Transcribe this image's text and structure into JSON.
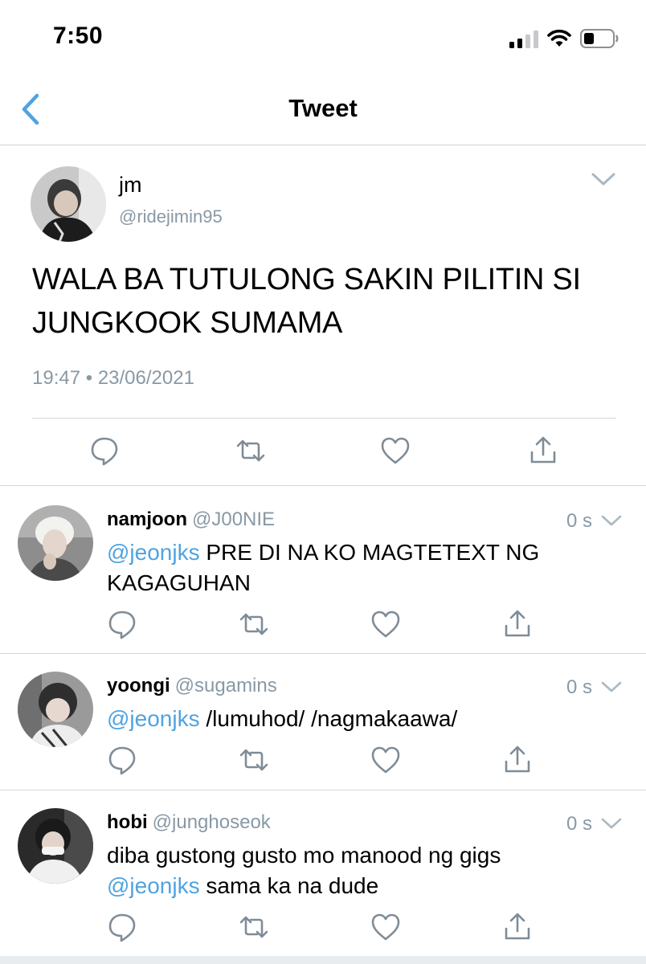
{
  "status_bar": {
    "time": "7:50"
  },
  "nav": {
    "title": "Tweet"
  },
  "main_tweet": {
    "name": "jm",
    "handle": "@ridejimin95",
    "text_line1": "WALA BA TUTULONG SAKIN PILITIN SI",
    "text_line2": "JUNGKOOK SUMAMA",
    "time": "19:47",
    "separator": "•",
    "date": "23/06/2021"
  },
  "replies": [
    {
      "name": "namjoon",
      "handle": "@J00NIE",
      "time": "0 s",
      "line1_mention": "@jeonjks",
      "line1_text": " PRE DI NA KO MAGTETEXT NG",
      "line2_text": "KAGAGUHAN"
    },
    {
      "name": "yoongi",
      "handle": "@sugamins",
      "time": "0 s",
      "line1_mention": "@jeonjks",
      "line1_text": " /lumuhod/ /nagmakaawa/"
    },
    {
      "name": "hobi",
      "handle": "@junghoseok",
      "time": "0 s",
      "line1_text": "diba gustong gusto mo manood ng gigs",
      "line2_mention": "@jeonjks",
      "line2_text": " sama ka na dude"
    }
  ],
  "colors": {
    "accent": "#4fa3e0",
    "secondary_text": "#8899a6",
    "divider": "#d3d7da",
    "icon": "#7f8c97"
  },
  "icons": {
    "back": "chevron-left-icon",
    "more": "chevron-down-icon",
    "reply": "speech-bubble-icon",
    "retweet": "retweet-icon",
    "like": "heart-icon",
    "share": "share-icon"
  }
}
